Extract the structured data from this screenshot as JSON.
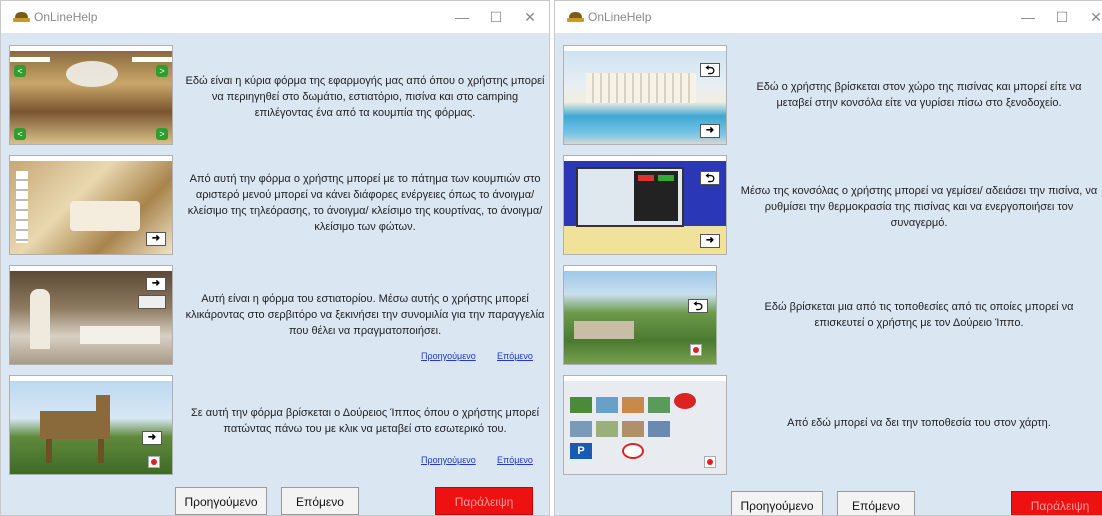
{
  "window_title": "OnLineHelp",
  "controls": {
    "minimize": "—",
    "maximize": "☐",
    "close": "✕"
  },
  "left": {
    "rows": [
      {
        "text": "Εδώ είναι η κύρια φόρμα της εφαρμογής μας από όπου ο χρήστης μπορεί να περιηγηθεί στο δωμάτιο, εστιατόριο, πισίνα και στο camping επιλέγοντας ένα από τα κουμπία της φόρμας."
      },
      {
        "text": "Από αυτή την φόρμα ο χρήστης μπορεί με το πάτημα των κουμπιών στο αριστερό μενού μπορεί να κάνει διάφορες ενέργειες όπως το άνοιγμα/ κλείσιμο της τηλεόρασης, το άνοιγμα/ κλείσιμο της κουρτίνας, το άνοιγμα/ κλείσιμο των φώτων."
      },
      {
        "text": "Αυτή είναι η φόρμα του εστιατορίου. Μέσω αυτής ο χρήστης μπορεί κλικάροντας στο σερβιτόρο να ξεκινήσει την συνομιλία για την παραγγελία που θέλει να πραγματοποιήσει.",
        "prev": "Προηγούμενο",
        "next": "Επόμενο"
      },
      {
        "text": "Σε αυτή την φόρμα βρίσκεται ο Δούρειος Ίππος όπου ο χρήστης μπορεί πατώντας πάνω του με κλικ να μεταβεί στο εσωτερικό του.",
        "prev": "Προηγούμενο",
        "next": "Επόμενο"
      }
    ],
    "buttons": {
      "prev": "Προηγούμενο",
      "next": "Επόμενο",
      "skip": "Παράλειψη"
    }
  },
  "right": {
    "rows": [
      {
        "text": "Εδώ ο χρήστης βρίσκεται στον χώρο της πισίνας και μπορεί είτε να μεταβεί στην κονσόλα είτε να γυρίσει πίσω στο ξενοδοχείο."
      },
      {
        "text": "Μέσω της κονσόλας ο χρήστης μπορεί να γεμίσει/ αδειάσει την πισίνα, να ρυθμίσει την θερμοκρασία της πισίνας και να ενεργοποιήσει τον συναγερμό."
      },
      {
        "text": "Εδώ βρίσκεται μια από τις τοποθεσίες από τις οποίες μπορεί να επισκευτεί ο χρήστης με τον Δούρειο Ίππο."
      },
      {
        "text": "Από εδώ μπορεί να δει την τοποθεσία του στον χάρτη."
      }
    ],
    "buttons": {
      "prev": "Προηγούμενο",
      "next": "Επόμενο",
      "skip": "Παράλειψη"
    }
  },
  "colors": {
    "window_bg": "#dbe6f3",
    "skip_bg": "#ee1111",
    "skip_text": "#ff9c9c",
    "link": "#1a3cc8"
  }
}
